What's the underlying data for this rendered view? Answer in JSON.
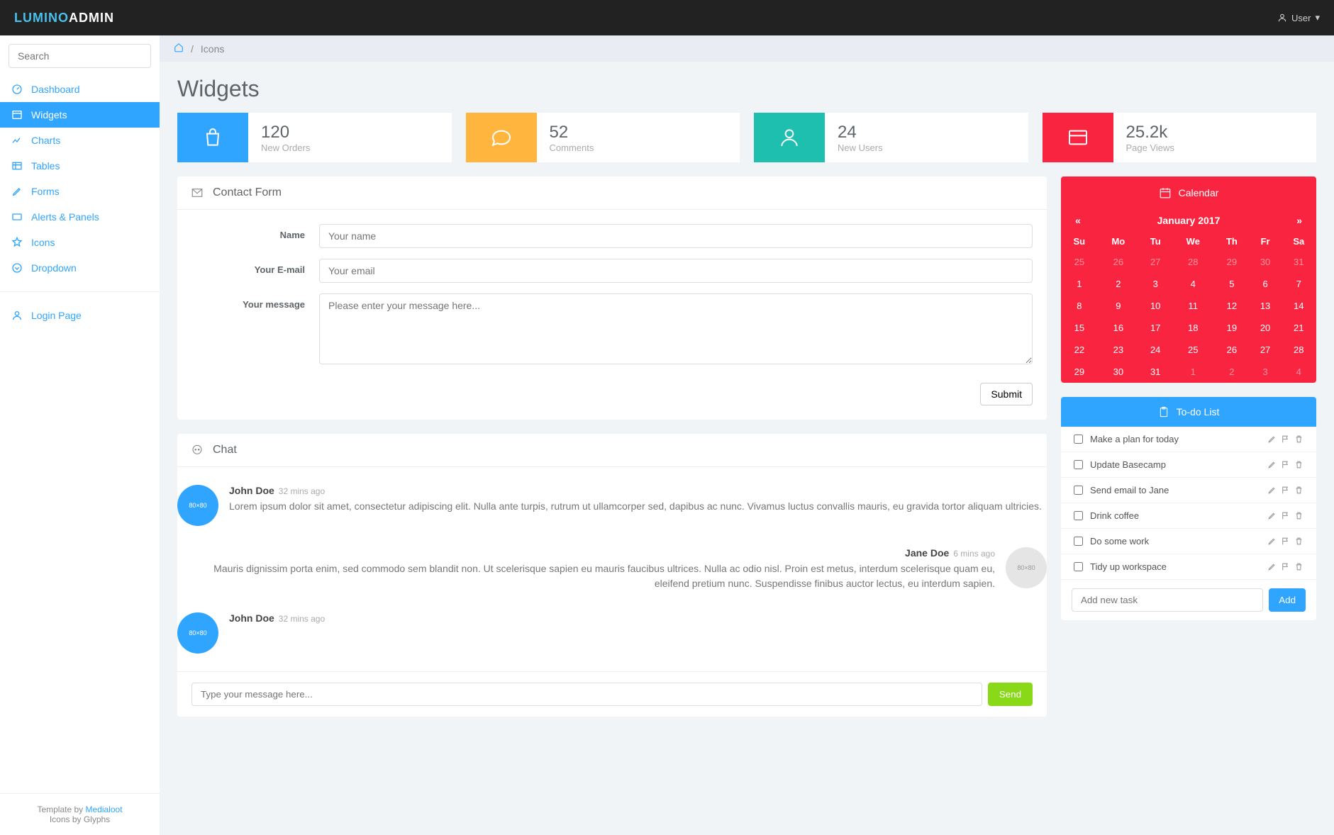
{
  "brand": {
    "left": "LUMINO",
    "right": "ADMIN"
  },
  "user_menu": "User",
  "search_placeholder": "Search",
  "sidebar": {
    "items": [
      {
        "label": "Dashboard"
      },
      {
        "label": "Widgets"
      },
      {
        "label": "Charts"
      },
      {
        "label": "Tables"
      },
      {
        "label": "Forms"
      },
      {
        "label": "Alerts & Panels"
      },
      {
        "label": "Icons"
      },
      {
        "label": "Dropdown"
      }
    ],
    "login": "Login Page"
  },
  "footer": {
    "t1": "Template by ",
    "link": "Medialoot",
    "t2": "Icons by Glyphs"
  },
  "breadcrumb": {
    "sep": "/",
    "page": "Icons"
  },
  "page_title": "Widgets",
  "stats": [
    {
      "num": "120",
      "label": "New Orders"
    },
    {
      "num": "52",
      "label": "Comments"
    },
    {
      "num": "24",
      "label": "New Users"
    },
    {
      "num": "25.2k",
      "label": "Page Views"
    }
  ],
  "contact_form": {
    "title": "Contact Form",
    "name_label": "Name",
    "name_ph": "Your name",
    "email_label": "Your E-mail",
    "email_ph": "Your email",
    "msg_label": "Your message",
    "msg_ph": "Please enter your message here...",
    "submit": "Submit"
  },
  "chat": {
    "title": "Chat",
    "items": [
      {
        "name": "John Doe",
        "time": "32 mins ago",
        "msg": "Lorem ipsum dolor sit amet, consectetur adipiscing elit. Nulla ante turpis, rutrum ut ullamcorper sed, dapibus ac nunc. Vivamus luctus convallis mauris, eu gravida tortor aliquam ultricies."
      },
      {
        "name": "Jane Doe",
        "time": "6 mins ago",
        "msg": "Mauris dignissim porta enim, sed commodo sem blandit non. Ut scelerisque sapien eu mauris faucibus ultrices. Nulla ac odio nisl. Proin est metus, interdum scelerisque quam eu, eleifend pretium nunc. Suspendisse finibus auctor lectus, eu interdum sapien."
      },
      {
        "name": "John Doe",
        "time": "32 mins ago",
        "msg": ""
      }
    ],
    "input_ph": "Type your message here...",
    "send": "Send"
  },
  "calendar": {
    "title": "Calendar",
    "prev": "«",
    "next": "»",
    "month": "January 2017",
    "dow": [
      "Su",
      "Mo",
      "Tu",
      "We",
      "Th",
      "Fr",
      "Sa"
    ],
    "weeks": [
      [
        {
          "d": "25",
          "m": 1
        },
        {
          "d": "26",
          "m": 1
        },
        {
          "d": "27",
          "m": 1
        },
        {
          "d": "28",
          "m": 1
        },
        {
          "d": "29",
          "m": 1
        },
        {
          "d": "30",
          "m": 1
        },
        {
          "d": "31",
          "m": 1
        }
      ],
      [
        {
          "d": "1"
        },
        {
          "d": "2"
        },
        {
          "d": "3"
        },
        {
          "d": "4"
        },
        {
          "d": "5"
        },
        {
          "d": "6"
        },
        {
          "d": "7"
        }
      ],
      [
        {
          "d": "8"
        },
        {
          "d": "9"
        },
        {
          "d": "10"
        },
        {
          "d": "11"
        },
        {
          "d": "12"
        },
        {
          "d": "13"
        },
        {
          "d": "14"
        }
      ],
      [
        {
          "d": "15"
        },
        {
          "d": "16"
        },
        {
          "d": "17"
        },
        {
          "d": "18"
        },
        {
          "d": "19"
        },
        {
          "d": "20"
        },
        {
          "d": "21"
        }
      ],
      [
        {
          "d": "22"
        },
        {
          "d": "23"
        },
        {
          "d": "24"
        },
        {
          "d": "25"
        },
        {
          "d": "26"
        },
        {
          "d": "27"
        },
        {
          "d": "28"
        }
      ],
      [
        {
          "d": "29"
        },
        {
          "d": "30"
        },
        {
          "d": "31"
        },
        {
          "d": "1",
          "m": 1
        },
        {
          "d": "2",
          "m": 1
        },
        {
          "d": "3",
          "m": 1
        },
        {
          "d": "4",
          "m": 1
        }
      ]
    ]
  },
  "todo": {
    "title": "To-do List",
    "items": [
      "Make a plan for today",
      "Update Basecamp",
      "Send email to Jane",
      "Drink coffee",
      "Do some work",
      "Tidy up workspace"
    ],
    "add_ph": "Add new task",
    "add_btn": "Add"
  }
}
